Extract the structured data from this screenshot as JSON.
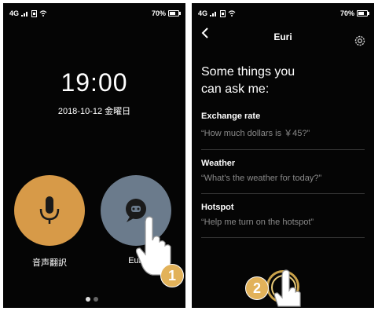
{
  "left_screen": {
    "status": {
      "network": "4G",
      "battery": "70%"
    },
    "time": "19:00",
    "date": "2018-10-12 金曜日",
    "apps": [
      {
        "label": "音声翻訳",
        "icon": "microphone-icon",
        "color": "#d79a48"
      },
      {
        "label": "Euri",
        "icon": "robot-icon",
        "color": "#6b7b8c"
      }
    ],
    "pager": {
      "count": 2,
      "active": 0
    },
    "step_badge": "1"
  },
  "right_screen": {
    "status": {
      "network": "4G",
      "battery": "70%"
    },
    "title": "Euri",
    "intro": [
      "Some things you",
      "can ask me:"
    ],
    "sections": [
      {
        "title": "Exchange rate",
        "example": "“How much dollars is ￥45?”"
      },
      {
        "title": "Weather",
        "example": "“What's the weather for today?”"
      },
      {
        "title": "Hotspot",
        "example": "“Help me turn on the hotspot”"
      }
    ],
    "step_badge": "2"
  },
  "colors": {
    "accent": "#d79a48",
    "badge": "#e2b25a",
    "bot": "#6b7b8c"
  }
}
